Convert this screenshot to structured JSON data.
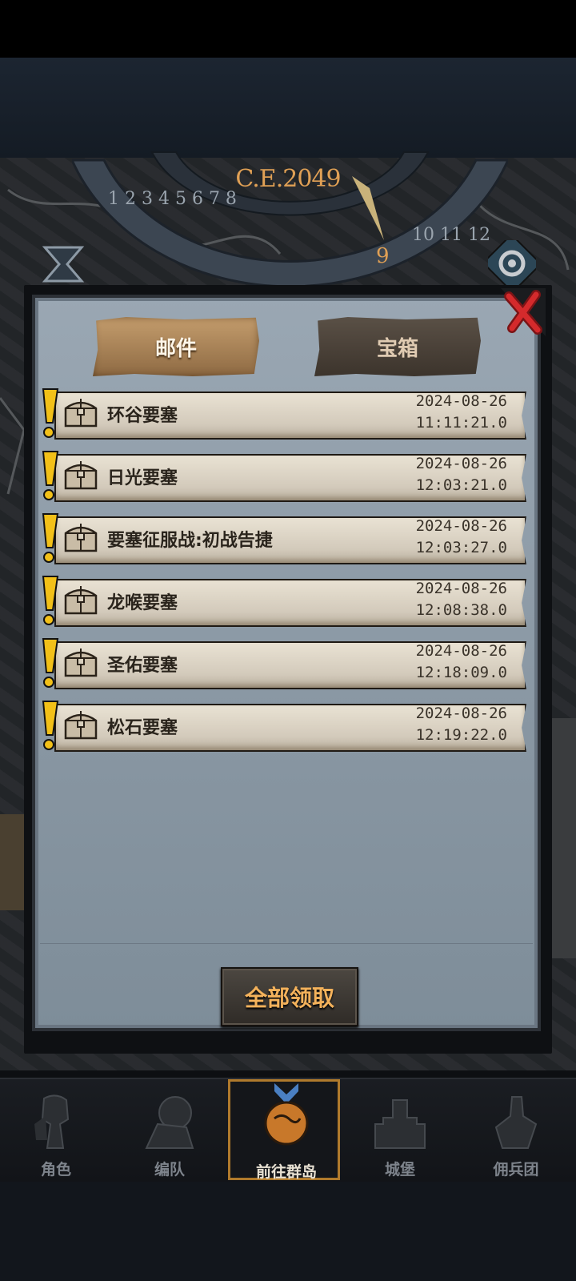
{
  "header": {
    "year": "C.E.2049"
  },
  "dialog": {
    "tabs": [
      {
        "label": "邮件",
        "active": true
      },
      {
        "label": "宝箱",
        "active": false
      }
    ],
    "mails": [
      {
        "title": "环谷要塞",
        "date": "2024-08-26",
        "time": "11:11:21.0"
      },
      {
        "title": "日光要塞",
        "date": "2024-08-26",
        "time": "12:03:21.0"
      },
      {
        "title": "要塞征服战:初战告捷",
        "date": "2024-08-26",
        "time": "12:03:27.0"
      },
      {
        "title": "龙喉要塞",
        "date": "2024-08-26",
        "time": "12:08:38.0"
      },
      {
        "title": "圣佑要塞",
        "date": "2024-08-26",
        "time": "12:18:09.0"
      },
      {
        "title": "松石要塞",
        "date": "2024-08-26",
        "time": "12:19:22.0"
      }
    ],
    "claim_all_label": "全部领取",
    "colors": {
      "accent": "#f4b25b",
      "close": "#c8282a",
      "unread_marker": "#f2c018"
    }
  },
  "bottom_nav": [
    {
      "label": "角色",
      "icon": "knight-icon"
    },
    {
      "label": "编队",
      "icon": "team-icon"
    },
    {
      "label": "前往群岛",
      "icon": "globe-icon",
      "active": true
    },
    {
      "label": "城堡",
      "icon": "castle-icon"
    },
    {
      "label": "佣兵团",
      "icon": "mercenary-icon"
    }
  ]
}
